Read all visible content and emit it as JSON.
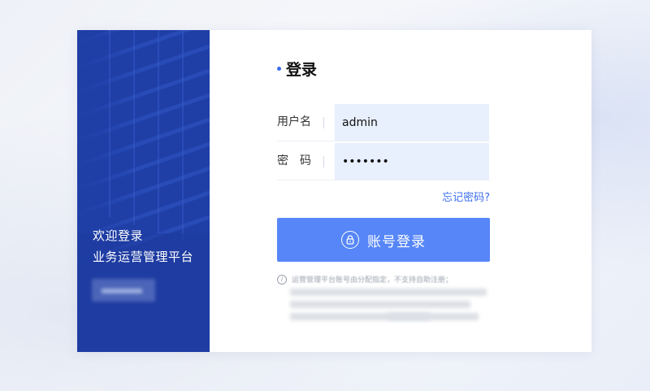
{
  "panel": {
    "welcome_line1": "欢迎登录",
    "welcome_line2": "业务运营管理平台"
  },
  "form": {
    "title": "登录",
    "username_label": "用户名",
    "username_value": "admin",
    "password_label": "密　码",
    "password_value": "•••••••",
    "forgot_label": "忘记密码?",
    "login_button": "账号登录",
    "note": "运营管理平台账号由分配指定，不支持自助注册；"
  },
  "colors": {
    "panel_bg": "#1f3fa6",
    "accent": "#3b6df0",
    "button_bg": "#5686f7",
    "input_bg": "#e8effd"
  },
  "icons": [
    "lock-icon",
    "info-icon"
  ]
}
